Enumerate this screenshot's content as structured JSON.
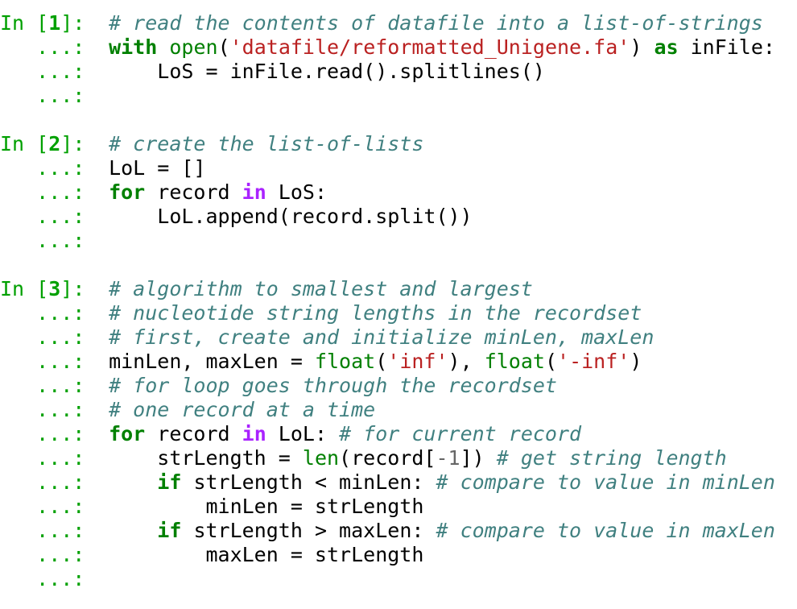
{
  "prompt": {
    "in_label": "In",
    "continuation": "   ...:"
  },
  "colors": {
    "prompt": "#00a000",
    "comment": "#408080",
    "keyword": "#008000",
    "operator_word": "#aa22ff",
    "builtin": "#008000",
    "string": "#ba2121",
    "text": "#000000"
  },
  "cells": [
    {
      "number": "1",
      "lines": [
        [
          {
            "t": "# read the contents of datafile into a list-of-strings",
            "k": "comment"
          }
        ],
        [
          {
            "t": "with",
            "k": "keyword"
          },
          {
            "t": " ",
            "k": "plain"
          },
          {
            "t": "open",
            "k": "builtin"
          },
          {
            "t": "(",
            "k": "plain"
          },
          {
            "t": "'datafile/reformatted_Unigene.fa'",
            "k": "string"
          },
          {
            "t": ") ",
            "k": "plain"
          },
          {
            "t": "as",
            "k": "keyword"
          },
          {
            "t": " inFile:",
            "k": "plain"
          }
        ],
        [
          {
            "t": "    LoS = inFile.read().splitlines()",
            "k": "plain"
          }
        ],
        []
      ]
    },
    {
      "number": "2",
      "lines": [
        [
          {
            "t": "# create the list-of-lists",
            "k": "comment"
          }
        ],
        [
          {
            "t": "LoL = []",
            "k": "plain"
          }
        ],
        [
          {
            "t": "for",
            "k": "keyword"
          },
          {
            "t": " record ",
            "k": "plain"
          },
          {
            "t": "in",
            "k": "opword"
          },
          {
            "t": " LoS:",
            "k": "plain"
          }
        ],
        [
          {
            "t": "    LoL.append(record.split())",
            "k": "plain"
          }
        ],
        []
      ]
    },
    {
      "number": "3",
      "lines": [
        [
          {
            "t": "# algorithm to smallest and largest",
            "k": "comment"
          }
        ],
        [
          {
            "t": "# nucleotide string lengths in the recordset",
            "k": "comment"
          }
        ],
        [
          {
            "t": "# first, create and initialize minLen, maxLen",
            "k": "comment"
          }
        ],
        [
          {
            "t": "minLen, maxLen = ",
            "k": "plain"
          },
          {
            "t": "float",
            "k": "builtin"
          },
          {
            "t": "(",
            "k": "plain"
          },
          {
            "t": "'inf'",
            "k": "string"
          },
          {
            "t": "), ",
            "k": "plain"
          },
          {
            "t": "float",
            "k": "builtin"
          },
          {
            "t": "(",
            "k": "plain"
          },
          {
            "t": "'-inf'",
            "k": "string"
          },
          {
            "t": ")",
            "k": "plain"
          }
        ],
        [
          {
            "t": "# for loop goes through the recordset",
            "k": "comment"
          }
        ],
        [
          {
            "t": "# one record at a time",
            "k": "comment"
          }
        ],
        [
          {
            "t": "for",
            "k": "keyword"
          },
          {
            "t": " record ",
            "k": "plain"
          },
          {
            "t": "in",
            "k": "opword"
          },
          {
            "t": " LoL: ",
            "k": "plain"
          },
          {
            "t": "# for current record",
            "k": "comment"
          }
        ],
        [
          {
            "t": "    strLength = ",
            "k": "plain"
          },
          {
            "t": "len",
            "k": "builtin"
          },
          {
            "t": "(record[",
            "k": "plain"
          },
          {
            "t": "-1",
            "k": "number"
          },
          {
            "t": "]) ",
            "k": "plain"
          },
          {
            "t": "# get string length",
            "k": "comment"
          }
        ],
        [
          {
            "t": "    ",
            "k": "plain"
          },
          {
            "t": "if",
            "k": "keyword"
          },
          {
            "t": " strLength < minLen: ",
            "k": "plain"
          },
          {
            "t": "# compare to value in minLen",
            "k": "comment"
          }
        ],
        [
          {
            "t": "        minLen = strLength",
            "k": "plain"
          }
        ],
        [
          {
            "t": "    ",
            "k": "plain"
          },
          {
            "t": "if",
            "k": "keyword"
          },
          {
            "t": " strLength > maxLen: ",
            "k": "plain"
          },
          {
            "t": "# compare to value in maxLen",
            "k": "comment"
          }
        ],
        [
          {
            "t": "        maxLen = strLength",
            "k": "plain"
          }
        ],
        []
      ]
    }
  ]
}
